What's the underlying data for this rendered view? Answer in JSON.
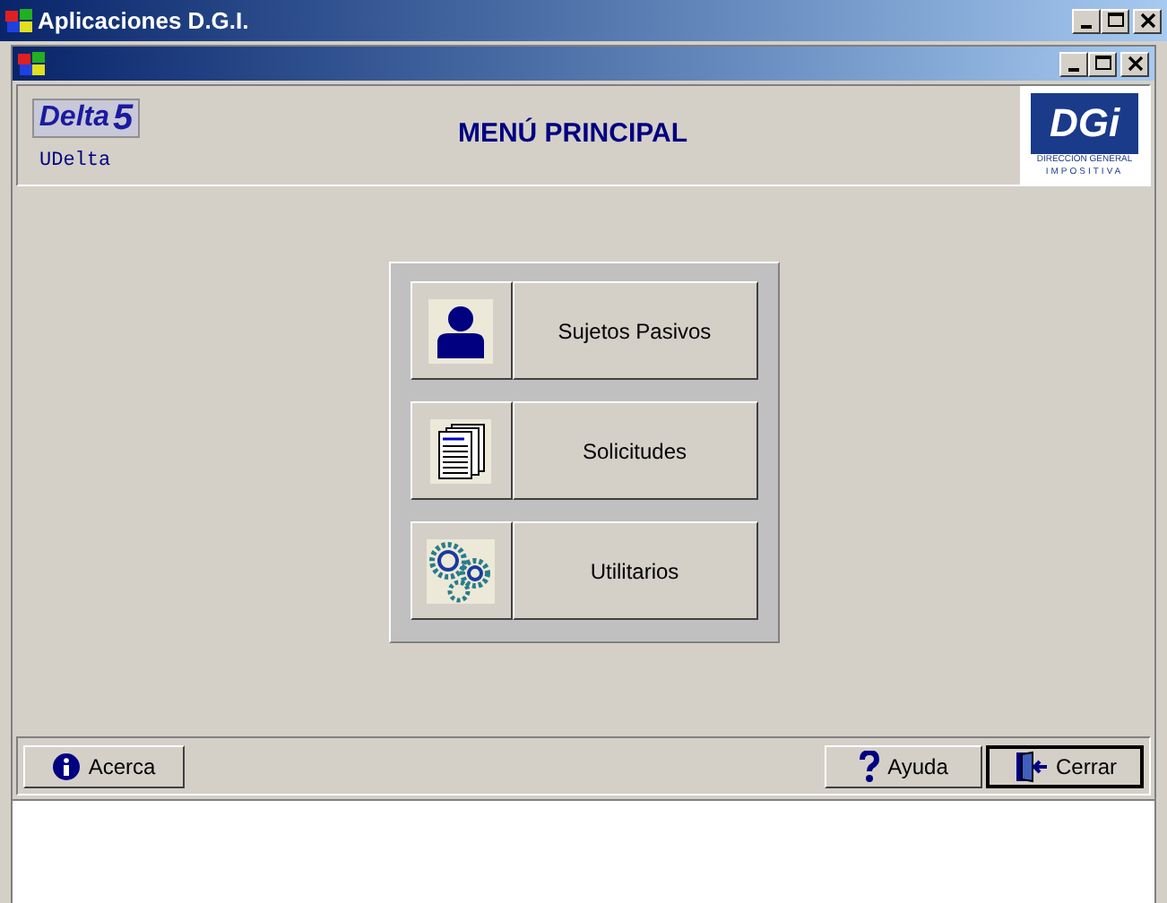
{
  "window": {
    "title": "Aplicaciones  D.G.I."
  },
  "header": {
    "product": "Delta",
    "version": "5",
    "module": "UDelta",
    "title": "MENÚ PRINCIPAL",
    "logo": {
      "letters": "DGi",
      "line_1": "DIRECCIÓN GENERAL",
      "line_2": "IMPOSITIVA"
    }
  },
  "menu": [
    {
      "kind": "person",
      "label": "Sujetos Pasivos"
    },
    {
      "kind": "documents",
      "label": "Solicitudes"
    },
    {
      "kind": "gears",
      "label": "Utilitarios"
    }
  ],
  "footer": {
    "left": [
      {
        "kind": "info",
        "label": "Acerca",
        "default": false
      }
    ],
    "right": [
      {
        "kind": "help",
        "label": "Ayuda",
        "default": false
      },
      {
        "kind": "exit",
        "label": "Cerrar",
        "default": true
      }
    ]
  }
}
